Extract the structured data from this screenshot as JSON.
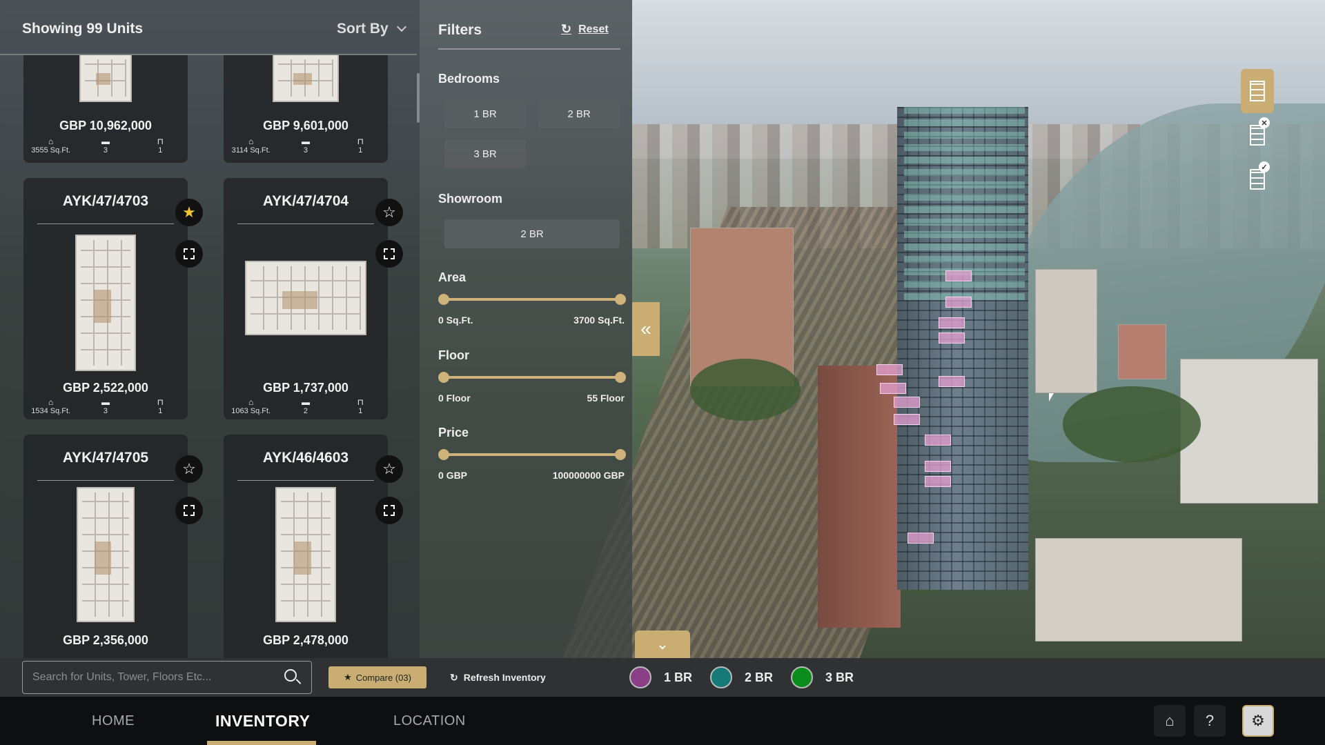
{
  "list": {
    "showing": "Showing 99 Units",
    "sort_label": "Sort By",
    "cards": [
      {
        "code": "",
        "price": "GBP 10,962,000",
        "area": "3555 Sq.Ft.",
        "beds": "3",
        "baths": "1",
        "fav": false
      },
      {
        "code": "",
        "price": "GBP 9,601,000",
        "area": "3114 Sq.Ft.",
        "beds": "3",
        "baths": "1",
        "fav": false
      },
      {
        "code": "AYK/47/4703",
        "price": "GBP 2,522,000",
        "area": "1534 Sq.Ft.",
        "beds": "3",
        "baths": "1",
        "fav": true
      },
      {
        "code": "AYK/47/4704",
        "price": "GBP 1,737,000",
        "area": "1063 Sq.Ft.",
        "beds": "2",
        "baths": "1",
        "fav": false
      },
      {
        "code": "AYK/47/4705",
        "price": "GBP 2,356,000",
        "area": "",
        "beds": "",
        "baths": "",
        "fav": false
      },
      {
        "code": "AYK/46/4603",
        "price": "GBP 2,478,000",
        "area": "",
        "beds": "",
        "baths": "",
        "fav": false
      }
    ]
  },
  "filters": {
    "title": "Filters",
    "reset": "Reset",
    "bedrooms_label": "Bedrooms",
    "bedrooms": [
      "1 BR",
      "2 BR",
      "3 BR"
    ],
    "showroom_label": "Showroom",
    "showroom": [
      "2 BR"
    ],
    "area": {
      "label": "Area",
      "min": "0 Sq.Ft.",
      "max": "3700 Sq.Ft."
    },
    "floor": {
      "label": "Floor",
      "min": "0 Floor",
      "max": "55 Floor"
    },
    "price": {
      "label": "Price",
      "min": "0 GBP",
      "max": "100000000 GBP"
    }
  },
  "bottom": {
    "search_placeholder": "Search for Units, Tower, Floors Etc...",
    "compare": "Compare (03)",
    "refresh": "Refresh Inventory",
    "legend": [
      {
        "label": "1 BR",
        "color": "#8a3f86"
      },
      {
        "label": "2 BR",
        "color": "#157a78"
      },
      {
        "label": "3 BR",
        "color": "#0b8c1d"
      }
    ]
  },
  "nav": {
    "tabs": [
      "HOME",
      "INVENTORY",
      "LOCATION"
    ],
    "active": "INVENTORY"
  },
  "colors": {
    "accent": "#c9ad72",
    "highlight": "#e6a0d2"
  }
}
